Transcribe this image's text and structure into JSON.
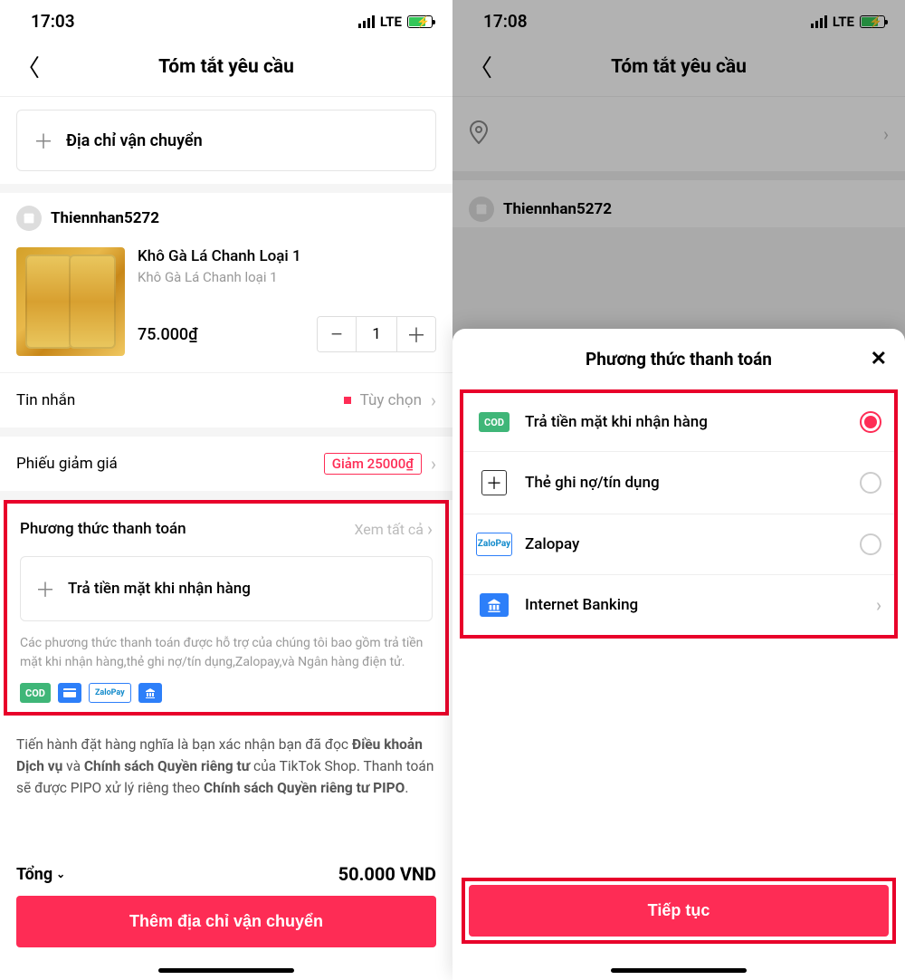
{
  "left": {
    "status": {
      "time": "17:03",
      "network": "LTE"
    },
    "title": "Tóm tắt yêu cầu",
    "address_label": "Địa chỉ vận chuyển",
    "shop_name": "Thiennhan5272",
    "product": {
      "title": "Khô Gà Lá Chanh Loại 1",
      "subtitle": "Khô Gà Lá Chanh loại 1",
      "price": "75.000₫",
      "qty": "1"
    },
    "message_label": "Tin nhắn",
    "message_option": "Tùy chọn",
    "coupon_label": "Phiếu giảm giá",
    "coupon_value": "Giảm 25000₫",
    "payment_header": "Phương thức thanh toán",
    "view_all": "Xem tất cả",
    "payment_option": "Trả tiền mặt khi nhận hàng",
    "payment_note": "Các phương thức thanh toán được hỗ trợ của chúng tôi bao gồm trả tiền mặt khi nhận hàng,thẻ ghi nợ/tín dụng,Zalopay,và Ngân hàng điện tử.",
    "icons": {
      "cod": "COD",
      "zalo": "ZaloPay"
    },
    "terms_plain1": "Tiến hành đặt hàng nghĩa là bạn xác nhận bạn đã đọc ",
    "terms_bold1": "Điều khoản Dịch vụ",
    "terms_plain2": " và ",
    "terms_bold2": "Chính sách Quyền riêng tư",
    "terms_plain3": " của TikTok Shop. Thanh toán sẽ được PIPO xử lý riêng theo ",
    "terms_bold3": "Chính sách Quyền riêng tư PIPO",
    "terms_plain4": ".",
    "total_label": "Tổng",
    "total_value": "50.000 VND",
    "cta": "Thêm địa chỉ vận chuyển"
  },
  "right": {
    "status": {
      "time": "17:08",
      "network": "LTE"
    },
    "title": "Tóm tắt yêu cầu",
    "shop_name": "Thiennhan5272",
    "sheet_title": "Phương thức thanh toán",
    "options": {
      "cod_badge": "COD",
      "cod_label": "Trả tiền mặt khi nhận hàng",
      "card_label": "Thẻ ghi nợ/tín dụng",
      "zalo_badge": "ZaloPay",
      "zalo_label": "Zalopay",
      "bank_label": "Internet Banking"
    },
    "cta": "Tiếp tục"
  }
}
